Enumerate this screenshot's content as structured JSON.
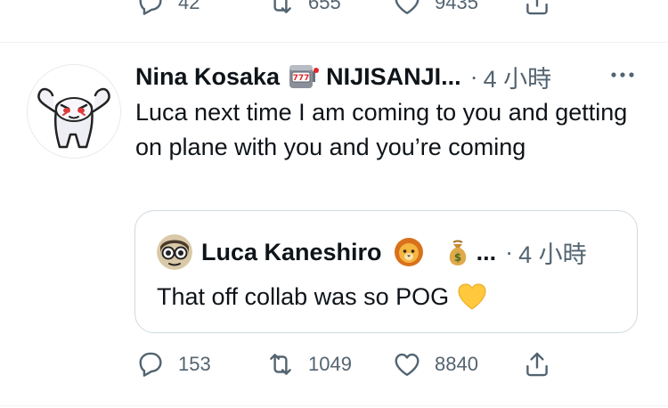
{
  "previous_tweet": {
    "reply_count": "42",
    "retweet_count": "655",
    "like_count": "9435"
  },
  "tweet": {
    "author_name": "Nina Kosaka",
    "author_org": "NIJISANJI...",
    "separator": "·",
    "time": "4 小時",
    "text": "Luca next time I am coming to you and getting on plane with you and you’re coming",
    "quote": {
      "author_name": "Luca Kaneshiro",
      "ellipsis": "...",
      "separator": "·",
      "time": "4 小時",
      "text": "That off collab was so POG"
    },
    "reply_count": "153",
    "retweet_count": "1049",
    "like_count": "8840"
  },
  "icons": {
    "reply": "reply-icon",
    "retweet": "retweet-icon",
    "like": "like-icon",
    "share": "share-icon",
    "more": "more-icon",
    "slot_machine": "slot-machine-emoji-icon",
    "lion": "lion-emoji-icon",
    "money_bag": "money-bag-emoji-icon",
    "yellow_heart": "yellow-heart-emoji-icon"
  },
  "colors": {
    "text_primary": "#0f1419",
    "text_secondary": "#536471",
    "border": "#cfd9de",
    "divider": "#eff3f4",
    "heart_yellow": "#ffc83d"
  }
}
